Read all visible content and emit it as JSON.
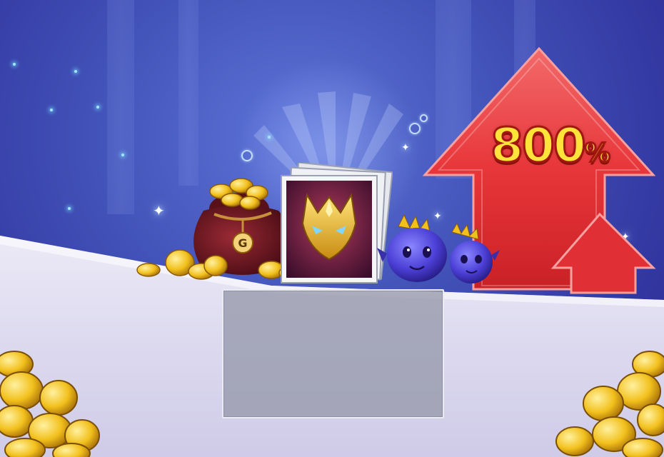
{
  "banner": {
    "multiplier_value": "800",
    "multiplier_unit": "%"
  },
  "colors": {
    "arrow_red": "#e8363a",
    "arrow_dark": "#b3191c",
    "gold": "#f2c01c",
    "label_yellow": "#ffe23a",
    "sky_blue": "#4252b8",
    "ground_lavender": "#d9d7ee"
  },
  "icons": {
    "money_bag": "money-bag-icon",
    "mask_card": "golden-mask-card-icon",
    "slime": "purple-slime-icon",
    "coin_pile": "gold-coin-pile-icon",
    "arrow": "red-up-arrow-icon"
  },
  "bag_emblem": "G"
}
